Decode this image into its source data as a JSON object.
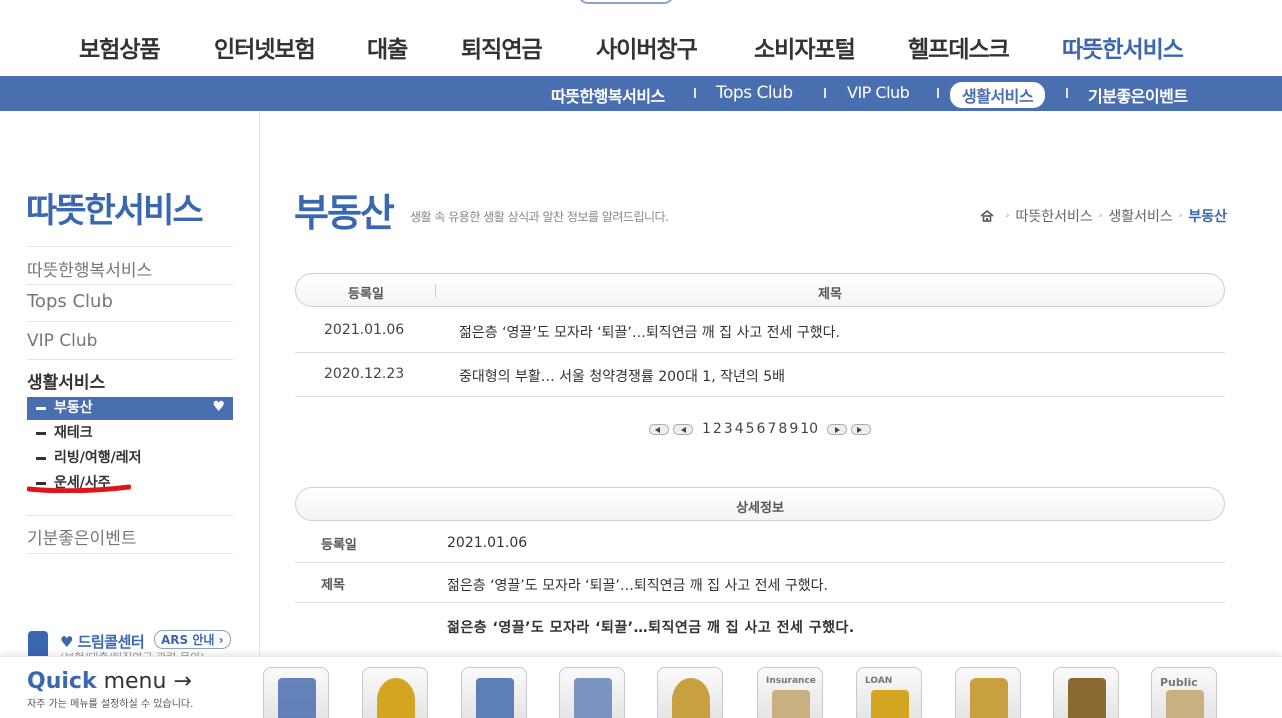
{
  "topnav": {
    "items": [
      "보험상품",
      "인터넷보험",
      "대출",
      "퇴직연금",
      "사이버창구",
      "소비자포털",
      "헬프데스크",
      "따뜻한서비스"
    ]
  },
  "subnav": {
    "items": [
      "따뜻한행복서비스",
      "Tops Club",
      "VIP Club",
      "생활서비스",
      "기분좋은이벤트"
    ]
  },
  "sidebar": {
    "title": "따뜻한서비스",
    "links": [
      "따뜻한행복서비스",
      "Tops Club",
      "VIP Club"
    ],
    "section": "생활서비스",
    "subs": [
      "부동산",
      "재테크",
      "리빙/여행/레저",
      "운세/사주"
    ],
    "last_link": "기분좋은이벤트",
    "callcenter": {
      "title": "♥ 드림콜센터",
      "ars": "ARS 안내 ›",
      "note": "(보험/대출/퇴직연금 관련 문의)"
    }
  },
  "main": {
    "title": "부동산",
    "description": "생활 속 유용한 생활 상식과 알찬 정보를 알려드립니다.",
    "breadcrumb": [
      "따뜻한서비스",
      "생활서비스",
      "부동산"
    ],
    "list": {
      "col_date": "등록일",
      "col_title": "제목",
      "rows": [
        {
          "date": "2021.01.06",
          "title": "젊은층 ‘영끌’도 모자라 ‘퇴끌’…퇴직연금 깨 집 사고 전세 구했다."
        },
        {
          "date": "2020.12.23",
          "title": "중대형의 부활… 서울 청약경쟁률 200대 1, 작년의 5배"
        }
      ]
    },
    "pager": {
      "pages": [
        "1",
        "2",
        "3",
        "4",
        "5",
        "6",
        "7",
        "8",
        "9",
        "10"
      ]
    },
    "detail": {
      "header": "상세정보",
      "date_label": "등록일",
      "date_value": "2021.01.06",
      "title_label": "제목",
      "title_value": "젊은층 ‘영끌’도 모자라 ‘퇴끌’…퇴직연금 깨 집 사고 전세 구했다.",
      "body": "젊은층 ‘영끌’도 모자라 ‘퇴끌’…퇴직연금 깨 집 사고 전세 구했다."
    }
  },
  "quick": {
    "title": "Quick",
    "title2": " menu →",
    "subtitle": "자주 가는 메뉴를 설정하실 수 있습니다.",
    "icons": [
      {
        "name": "report-icon",
        "label": "",
        "color": "#4a6fb0"
      },
      {
        "name": "chat-icon",
        "label": "",
        "color": "#d4a520"
      },
      {
        "name": "building-icon",
        "label": "",
        "color": "#4a6fb0"
      },
      {
        "name": "search-document-icon",
        "label": "",
        "color": "#4a6fb0"
      },
      {
        "name": "moneybag-icon",
        "label": "",
        "color": "#c9a040"
      },
      {
        "name": "insurance-icon",
        "label": "Insurance",
        "color": "#b9a070"
      },
      {
        "name": "loan-icon",
        "label": "LOAN",
        "color": "#c9a040"
      },
      {
        "name": "mobile-icon",
        "label": "",
        "color": "#c9a040"
      },
      {
        "name": "book-icon",
        "label": "",
        "color": "#8a6a30"
      },
      {
        "name": "public-icon",
        "label": "Public",
        "color": "#b9a070"
      }
    ]
  }
}
